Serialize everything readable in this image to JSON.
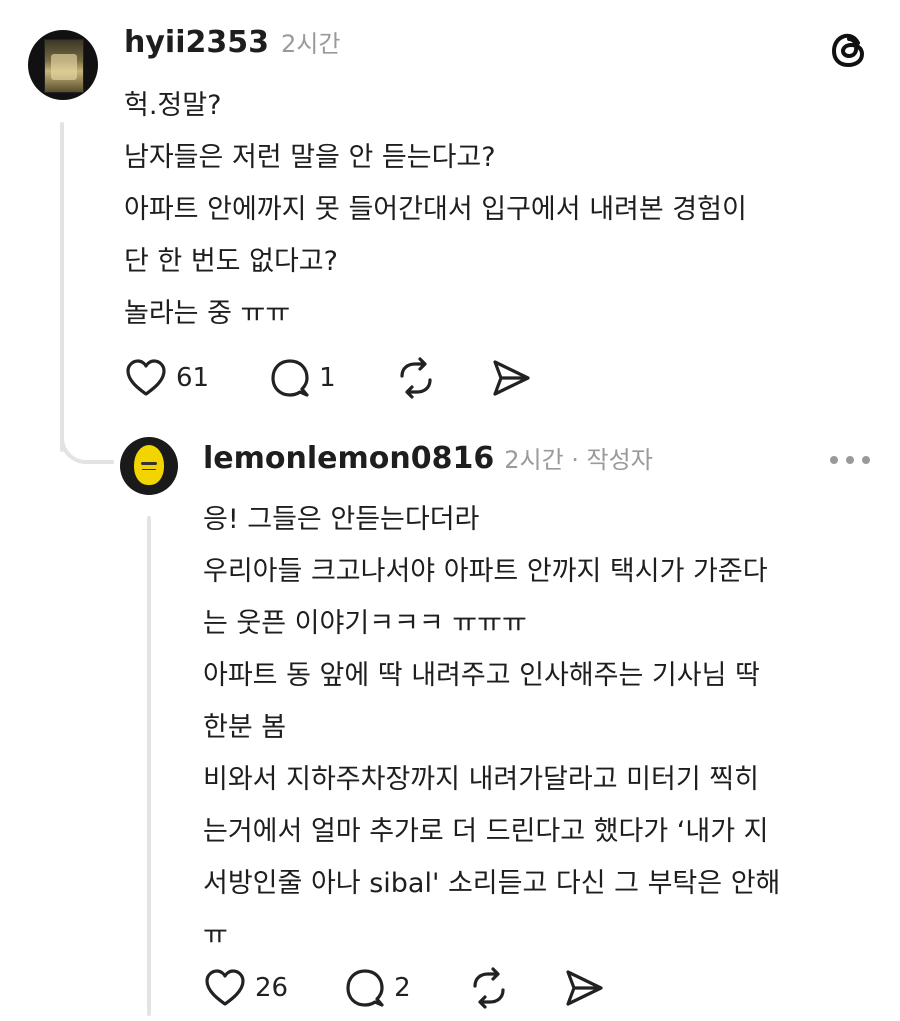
{
  "comment1": {
    "username": "hyii2353",
    "time": "2시간",
    "lines": [
      "헉.정말?",
      "남자들은 저런 말을 안 듣는다고?",
      "아파트 안에까지 못 들어간대서 입구에서 내려본 경험이",
      "단 한 번도 없다고?",
      "놀라는 중 ㅠㅠ"
    ],
    "likes": "61",
    "replies": "1"
  },
  "comment2": {
    "username": "lemonlemon0816",
    "time": "2시간 · 작성자",
    "lines": [
      "응! 그들은 안듣는다더라",
      "우리아들 크고나서야 아파트 안까지 택시가 가준다",
      "는 웃픈 이야기ㅋㅋㅋ ㅠㅠㅠ",
      "아파트 동 앞에 딱 내려주고 인사해주는 기사님 딱",
      "한분 봄",
      "비와서 지하주차장까지 내려가달라고 미터기 찍히",
      "는거에서 얼마 추가로 더 드린다고 했다가 ‘내가 지",
      "서방인줄 아나 sibal' 소리듣고 다신 그 부탁은 안해",
      "ㅠ"
    ],
    "likes": "26",
    "replies": "2"
  },
  "icons": {
    "app_logo": "threads-logo-icon",
    "more": "more-dots-icon",
    "like": "heart-icon",
    "reply": "comment-bubble-icon",
    "repost": "repost-icon",
    "share": "send-icon"
  }
}
